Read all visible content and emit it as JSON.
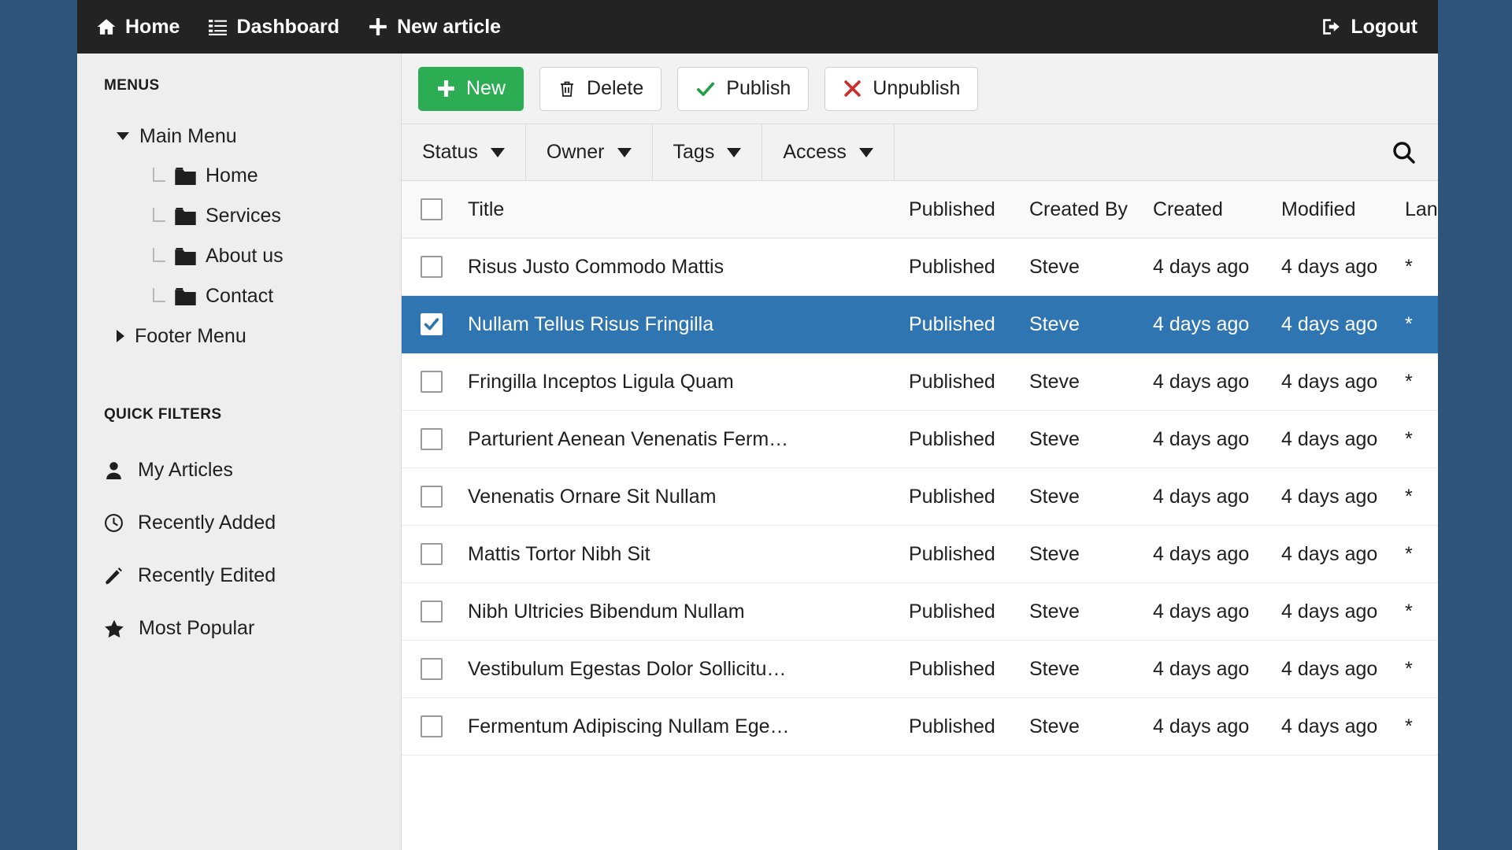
{
  "topnav": {
    "items": [
      {
        "label": "Home",
        "icon": "home-icon"
      },
      {
        "label": "Dashboard",
        "icon": "dashboard-icon"
      },
      {
        "label": "New article",
        "icon": "plus-icon"
      }
    ],
    "logout": {
      "label": "Logout",
      "icon": "logout-icon"
    }
  },
  "sidebar": {
    "menus_heading": "MENUS",
    "menu_groups": [
      {
        "label": "Main Menu",
        "expanded": true,
        "children": [
          {
            "label": "Home",
            "icon": "folder-icon"
          },
          {
            "label": "Services",
            "icon": "folder-icon"
          },
          {
            "label": "About us",
            "icon": "folder-icon"
          },
          {
            "label": "Contact",
            "icon": "folder-icon"
          }
        ]
      },
      {
        "label": "Footer Menu",
        "expanded": false,
        "children": []
      }
    ],
    "quick_filters_heading": "QUICK FILTERS",
    "quick_filters": [
      {
        "label": "My Articles",
        "icon": "user-icon"
      },
      {
        "label": "Recently Added",
        "icon": "clock-icon"
      },
      {
        "label": "Recently Edited",
        "icon": "pencil-icon"
      },
      {
        "label": "Most Popular",
        "icon": "star-icon"
      }
    ]
  },
  "toolbar": {
    "new_label": "New",
    "delete_label": "Delete",
    "publish_label": "Publish",
    "unpublish_label": "Unpublish"
  },
  "filterbar": {
    "filters": [
      {
        "label": "Status"
      },
      {
        "label": "Owner"
      },
      {
        "label": "Tags"
      },
      {
        "label": "Access"
      }
    ],
    "search_icon": "search-icon"
  },
  "table": {
    "columns": {
      "title": "Title",
      "published": "Published",
      "created_by": "Created By",
      "created": "Created",
      "modified": "Modified",
      "language": "Language"
    },
    "rows": [
      {
        "title": "Risus Justo Commodo Mattis",
        "published": "Published",
        "created_by": "Steve",
        "created": "4 days ago",
        "modified": "4 days ago",
        "language": "*",
        "selected": false
      },
      {
        "title": "Nullam Tellus Risus Fringilla",
        "published": "Published",
        "created_by": "Steve",
        "created": "4 days ago",
        "modified": "4 days ago",
        "language": "*",
        "selected": true
      },
      {
        "title": "Fringilla Inceptos Ligula Quam",
        "published": "Published",
        "created_by": "Steve",
        "created": "4 days ago",
        "modified": "4 days ago",
        "language": "*",
        "selected": false
      },
      {
        "title": "Parturient Aenean Venenatis Ferm…",
        "published": "Published",
        "created_by": "Steve",
        "created": "4 days ago",
        "modified": "4 days ago",
        "language": "*",
        "selected": false
      },
      {
        "title": "Venenatis Ornare Sit Nullam",
        "published": "Published",
        "created_by": "Steve",
        "created": "4 days ago",
        "modified": "4 days ago",
        "language": "*",
        "selected": false
      },
      {
        "title": "Mattis Tortor Nibh Sit",
        "published": "Published",
        "created_by": "Steve",
        "created": "4 days ago",
        "modified": "4 days ago",
        "language": "*",
        "selected": false
      },
      {
        "title": "Nibh Ultricies Bibendum Nullam",
        "published": "Published",
        "created_by": "Steve",
        "created": "4 days ago",
        "modified": "4 days ago",
        "language": "*",
        "selected": false
      },
      {
        "title": "Vestibulum Egestas Dolor Sollicitu…",
        "published": "Published",
        "created_by": "Steve",
        "created": "4 days ago",
        "modified": "4 days ago",
        "language": "*",
        "selected": false
      },
      {
        "title": "Fermentum Adipiscing Nullam Ege…",
        "published": "Published",
        "created_by": "Steve",
        "created": "4 days ago",
        "modified": "4 days ago",
        "language": "*",
        "selected": false
      }
    ]
  },
  "colors": {
    "page_background": "#2f547b",
    "topbar": "#232323",
    "sidebar": "#eeeeee",
    "primary_green": "#2cad54",
    "selected_row_blue": "#2f75b2",
    "publish_check_green": "#21a048",
    "unpublish_x_red": "#c9302c"
  }
}
